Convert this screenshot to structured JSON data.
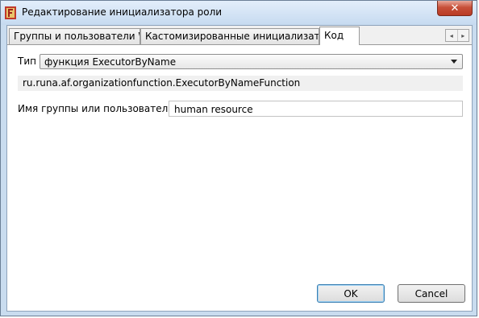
{
  "window": {
    "title": "Редактирование инициализатора роли",
    "close_glyph": "✕"
  },
  "tabs": [
    {
      "label": "Группы и пользователи WF",
      "active": false
    },
    {
      "label": "Кастомизированные инициализаторы",
      "active": false
    },
    {
      "label": "Код",
      "active": true
    }
  ],
  "tab_scroll": {
    "left_icon": "◂",
    "right_icon": "▸"
  },
  "form": {
    "type_label": "Тип",
    "type_value": "функция ExecutorByName",
    "class_name": "ru.runa.af.organizationfunction.ExecutorByNameFunction",
    "group_label": "Имя группы или пользователя *:",
    "group_value": "human resource"
  },
  "buttons": {
    "ok": "OK",
    "cancel": "Cancel"
  },
  "colors": {
    "accent": "#3c7fb1",
    "close": "#c7503a",
    "app_icon": "#c0392b"
  }
}
